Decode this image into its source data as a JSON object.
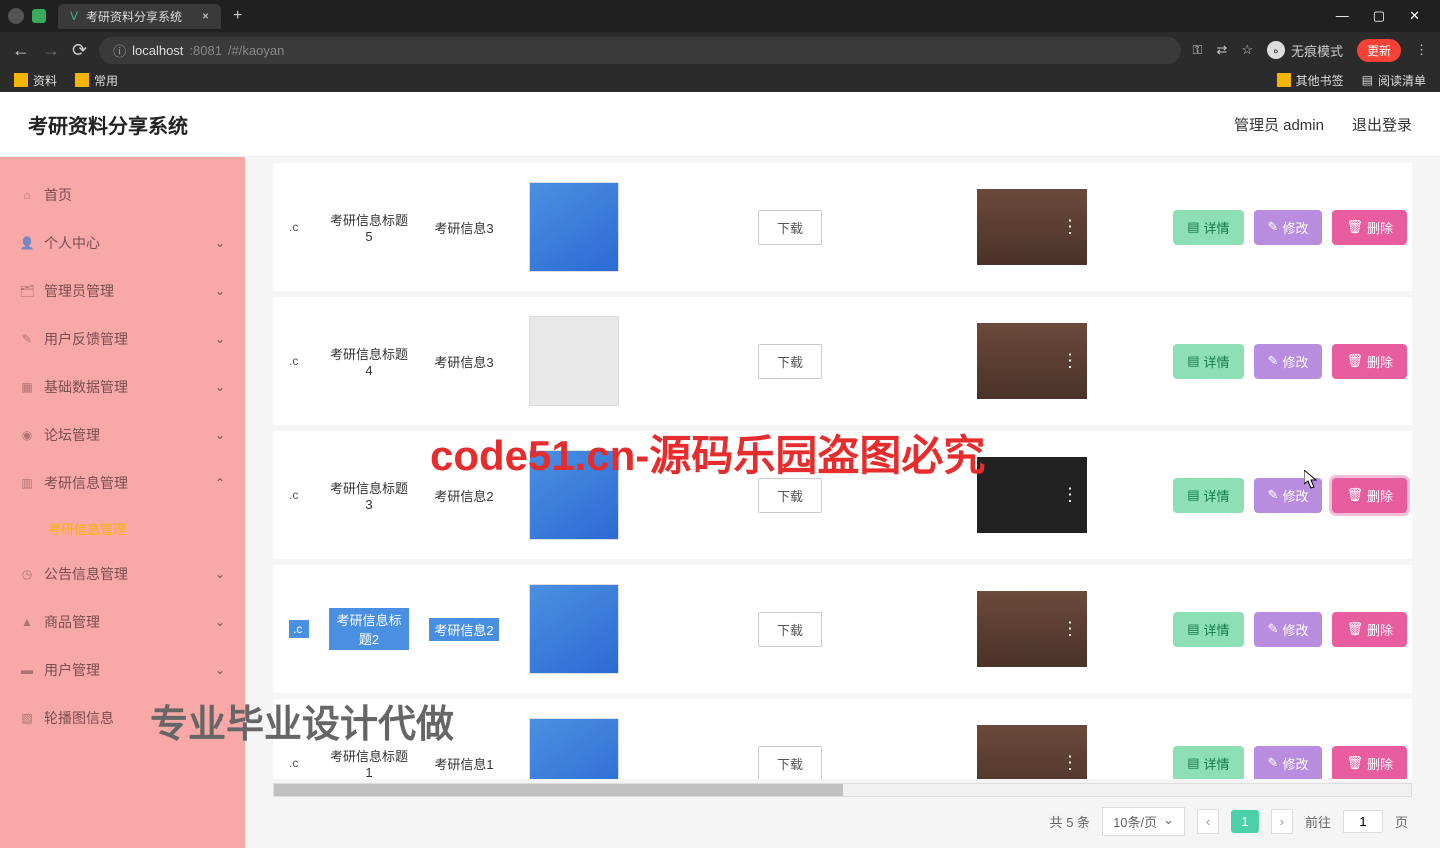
{
  "browser": {
    "tab_title": "考研资料分享系统",
    "url_info": "ⓘ",
    "url_host": "localhost",
    "url_port": ":8081",
    "url_path": "/#/kaoyan",
    "incognito_label": "无痕模式",
    "update_label": "更新",
    "bookmarks": {
      "b1": "资料",
      "b2": "常用",
      "r1": "其他书签",
      "r2": "阅读清单"
    }
  },
  "header": {
    "title": "考研资料分享系统",
    "user": "管理员 admin",
    "logout": "退出登录"
  },
  "sidebar": {
    "items": [
      {
        "icon": "⌂",
        "label": "首页"
      },
      {
        "icon": "👤",
        "label": "个人中心"
      },
      {
        "icon": "🗂",
        "label": "管理员管理"
      },
      {
        "icon": "✎",
        "label": "用户反馈管理"
      },
      {
        "icon": "▦",
        "label": "基础数据管理"
      },
      {
        "icon": "◉",
        "label": "论坛管理"
      },
      {
        "icon": "▥",
        "label": "考研信息管理"
      },
      {
        "icon": "◷",
        "label": "公告信息管理"
      },
      {
        "icon": "▲",
        "label": "商品管理"
      },
      {
        "icon": "▬",
        "label": "用户管理"
      },
      {
        "icon": "▧",
        "label": "轮播图信息"
      }
    ],
    "sub_label": "考研信息管理"
  },
  "table": {
    "download_label": "下载",
    "actions": {
      "detail": "详情",
      "edit": "修改",
      "del": "删除"
    },
    "rows": [
      {
        "ext": ".c",
        "title": "考研信息标题5",
        "cat": "考研信息3"
      },
      {
        "ext": ".c",
        "title": "考研信息标题4",
        "cat": "考研信息3"
      },
      {
        "ext": ".c",
        "title": "考研信息标题3",
        "cat": "考研信息2"
      },
      {
        "ext": ".c",
        "title": "考研信息标题2",
        "cat": "考研信息2"
      },
      {
        "ext": ".c",
        "title": "考研信息标题1",
        "cat": "考研信息1"
      }
    ]
  },
  "pagination": {
    "total_prefix": "共",
    "total_num": "5",
    "total_suffix": "条",
    "per_page": "10条/页",
    "current": "1",
    "goto_prefix": "前往",
    "goto_val": "1",
    "goto_suffix": "页"
  },
  "watermark": {
    "text": "code51.cn",
    "big": "code51.cn-源码乐园盗图必究",
    "bottom": "专业毕业设计代做"
  }
}
